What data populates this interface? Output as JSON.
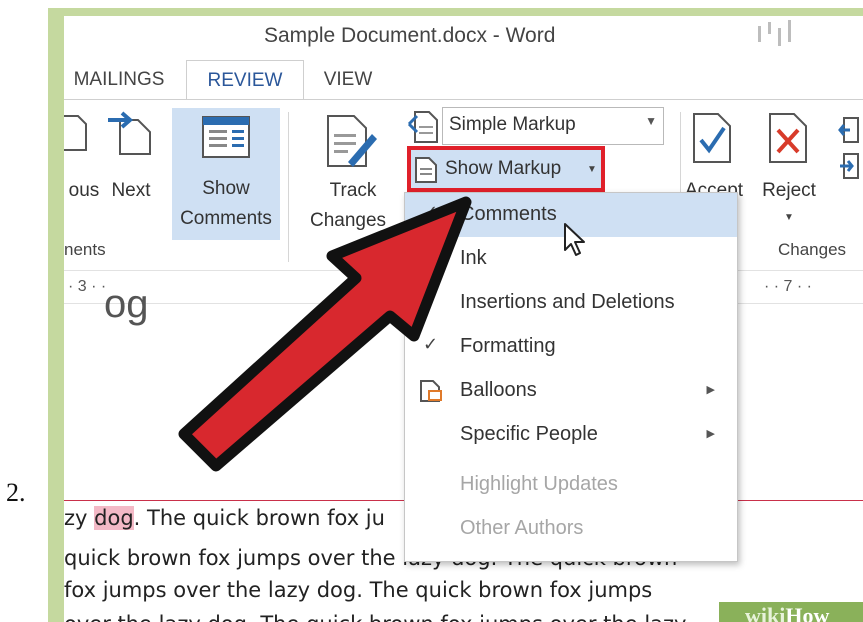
{
  "step": {
    "number": "2."
  },
  "window": {
    "title": "Sample Document.docx - Word"
  },
  "tabs": [
    {
      "label": "MAILINGS"
    },
    {
      "label": "REVIEW"
    },
    {
      "label": "VIEW"
    }
  ],
  "ribbon": {
    "previous_label": "ous",
    "next_label": "Next",
    "show_comments_line1": "Show",
    "show_comments_line2": "Comments",
    "track_changes_line1": "Track",
    "track_changes_line2": "Changes",
    "display_for_review": "Simple Markup",
    "show_markup": "Show Markup",
    "accept_label": "Accept",
    "reject_label": "Reject",
    "comments_group": "nents",
    "changes_group": "Changes"
  },
  "ruler": {
    "left": "· 3 · ·",
    "right": "· · 7 · ·"
  },
  "menu": {
    "items": [
      {
        "label": "Comments",
        "checked": true,
        "hover": true
      },
      {
        "label": "Ink"
      },
      {
        "label": "Insertions and Deletions",
        "checked": true
      },
      {
        "label": "Formatting",
        "checked": true
      },
      {
        "label": "Balloons",
        "submenu": true
      },
      {
        "label": "Specific People",
        "submenu": true
      },
      {
        "label": "Highlight Updates",
        "disabled": true
      },
      {
        "label": "Other Authors",
        "disabled": true
      }
    ],
    "check_glyph": "✓",
    "arrow_glyph": "▶"
  },
  "document": {
    "heading_fragment": "og",
    "line1_pre": "zy ",
    "line1_highlight": "dog",
    "line1_post": ".  The quick brown fox ju",
    "line2": "quick brown fox jumps over the lazy dog. The quick brown",
    "line3": "fox jumps over the lazy dog. The quick brown fox jumps",
    "line4": "over the lazy dog. The quick brown fox jumps over the lazy"
  },
  "watermark": {
    "wiki": "wiki",
    "how": "How"
  },
  "colors": {
    "highlight_box": "#e0202a",
    "arrow_fill": "#d8282e",
    "frame": "#c5d99f",
    "selected": "#cfe0f3"
  }
}
